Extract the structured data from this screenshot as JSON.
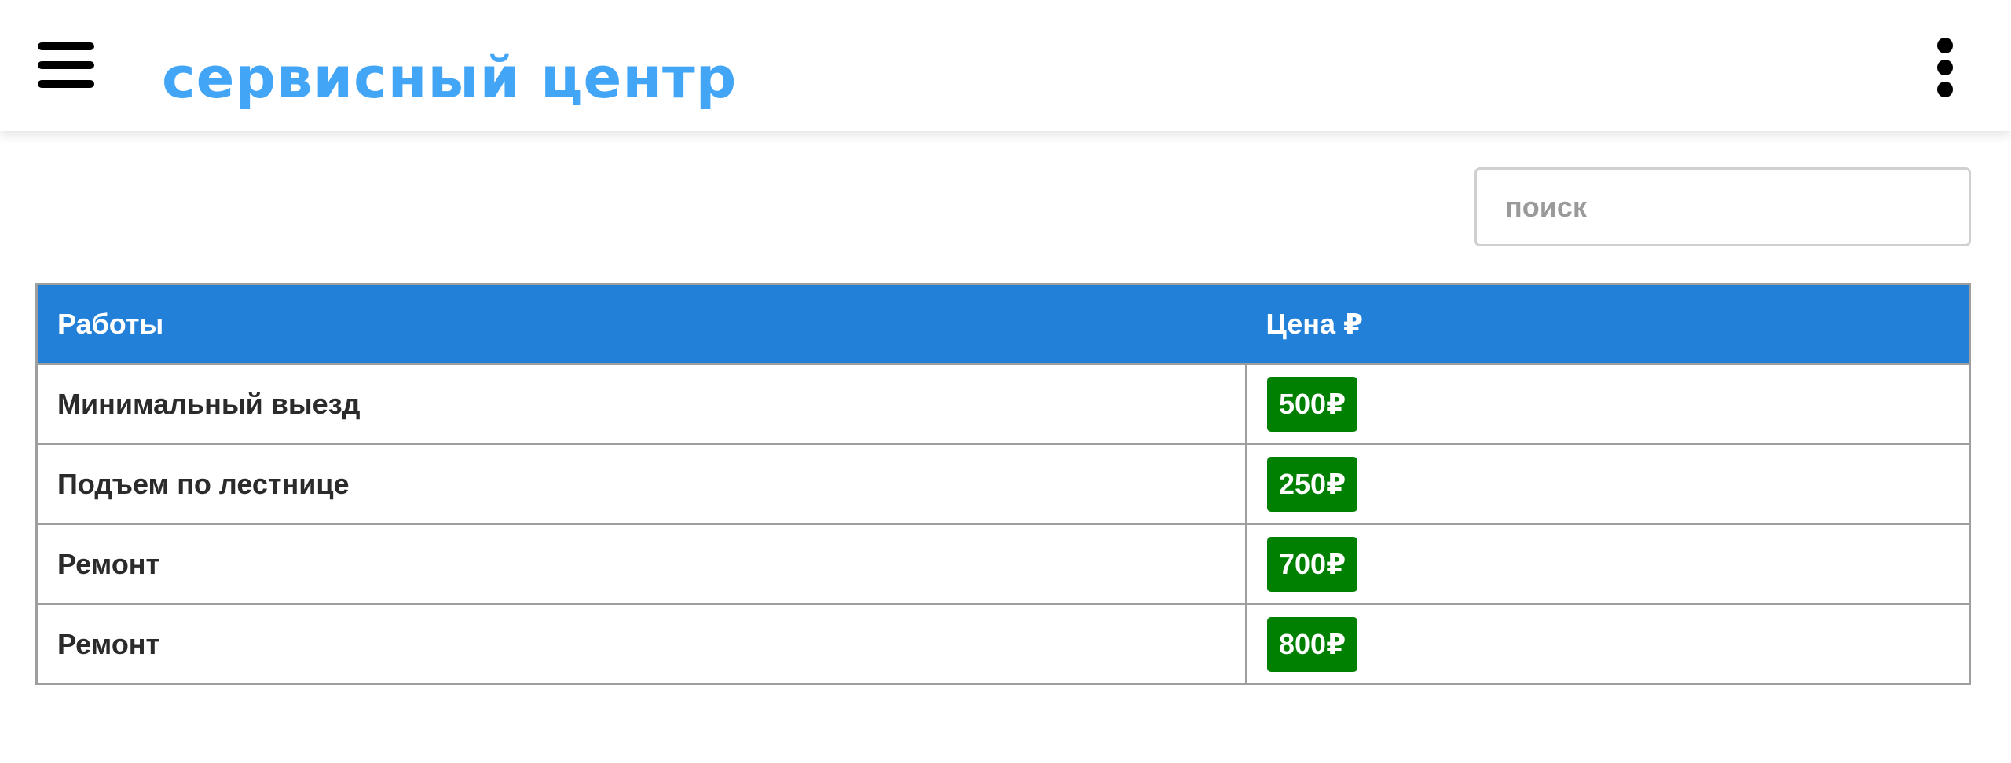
{
  "header": {
    "title": "сервисный центр",
    "menu_icon": "hamburger-menu-icon",
    "more_icon": "vertical-dots-icon"
  },
  "search": {
    "placeholder": "поиск",
    "value": ""
  },
  "table": {
    "columns": [
      "Работы",
      "Цена ₽"
    ],
    "rows": [
      {
        "work": "Минимальный выезд",
        "price": "500₽"
      },
      {
        "work": "Подъем по лестнице",
        "price": "250₽"
      },
      {
        "work": "Ремонт",
        "price": "700₽"
      },
      {
        "work": "Ремонт",
        "price": "800₽"
      }
    ]
  },
  "colors": {
    "title": "#42a5f5",
    "table_header": "#2280d8",
    "price_badge": "#008000"
  }
}
